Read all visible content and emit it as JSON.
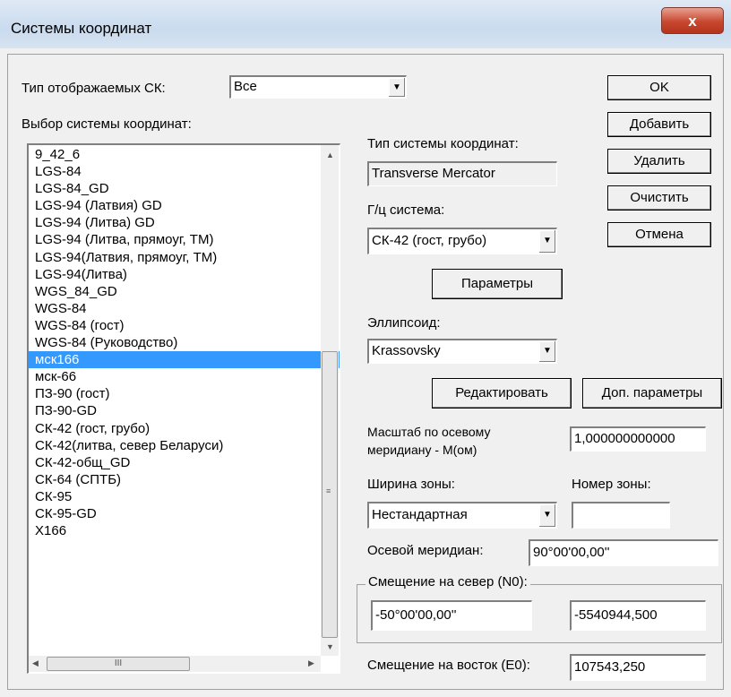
{
  "window": {
    "title": "Системы координат",
    "close_label": "x"
  },
  "display_type": {
    "label": "Тип отображаемых СК:",
    "value": "Все"
  },
  "list": {
    "label": "Выбор системы координат:",
    "items": [
      "9_42_6",
      "LGS-84",
      "LGS-84_GD",
      "LGS-94 (Латвия) GD",
      "LGS-94 (Литва) GD",
      "LGS-94 (Литва, прямоуг, ТМ)",
      "LGS-94(Латвия, прямоуг, ТМ)",
      "LGS-94(Литва)",
      "WGS_84_GD",
      "WGS-84",
      "WGS-84 (гост)",
      "WGS-84 (Руководство)",
      "мск166",
      "мск-66",
      "ПЗ-90 (гост)",
      "ПЗ-90-GD",
      "СК-42 (гост, грубо)",
      "СК-42(литва, север Беларуси)",
      "СК-42-общ_GD",
      "СК-64 (СПТБ)",
      "СК-95",
      "СК-95-GD",
      "X166"
    ],
    "selected_index": 12,
    "selected_color": "#3399ff"
  },
  "buttons": {
    "ok": "OK",
    "add": "Добавить",
    "delete": "Удалить",
    "clear": "Очистить",
    "cancel": "Отмена",
    "params": "Параметры",
    "edit": "Редактировать",
    "extra_params": "Доп. параметры"
  },
  "cs_type": {
    "label": "Тип системы координат:",
    "value": "Transverse Mercator"
  },
  "geo_system": {
    "label": "Г/ц система:",
    "value": "СК-42 (гост, грубо)"
  },
  "ellipsoid": {
    "label": "Эллипсоид:",
    "value": "Krassovsky"
  },
  "scale": {
    "label1": "Масштаб по осевому",
    "label2": "меридиану - М(ом)",
    "value": "1,000000000000"
  },
  "zone_width": {
    "label": "Ширина зоны:",
    "value": "Нестандартная"
  },
  "zone_number": {
    "label": "Номер зоны:",
    "value": ""
  },
  "central_meridian": {
    "label": "Осевой меридиан:",
    "value": "90°00'00,00''"
  },
  "north_offset": {
    "label": "Смещение на север (N0):",
    "value_left": "-50°00'00,00''",
    "value_right": "-5540944,500"
  },
  "east_offset": {
    "label": "Смещение на восток (E0):",
    "value": "107543,250"
  },
  "scroll": {
    "thumb_label": "III"
  }
}
